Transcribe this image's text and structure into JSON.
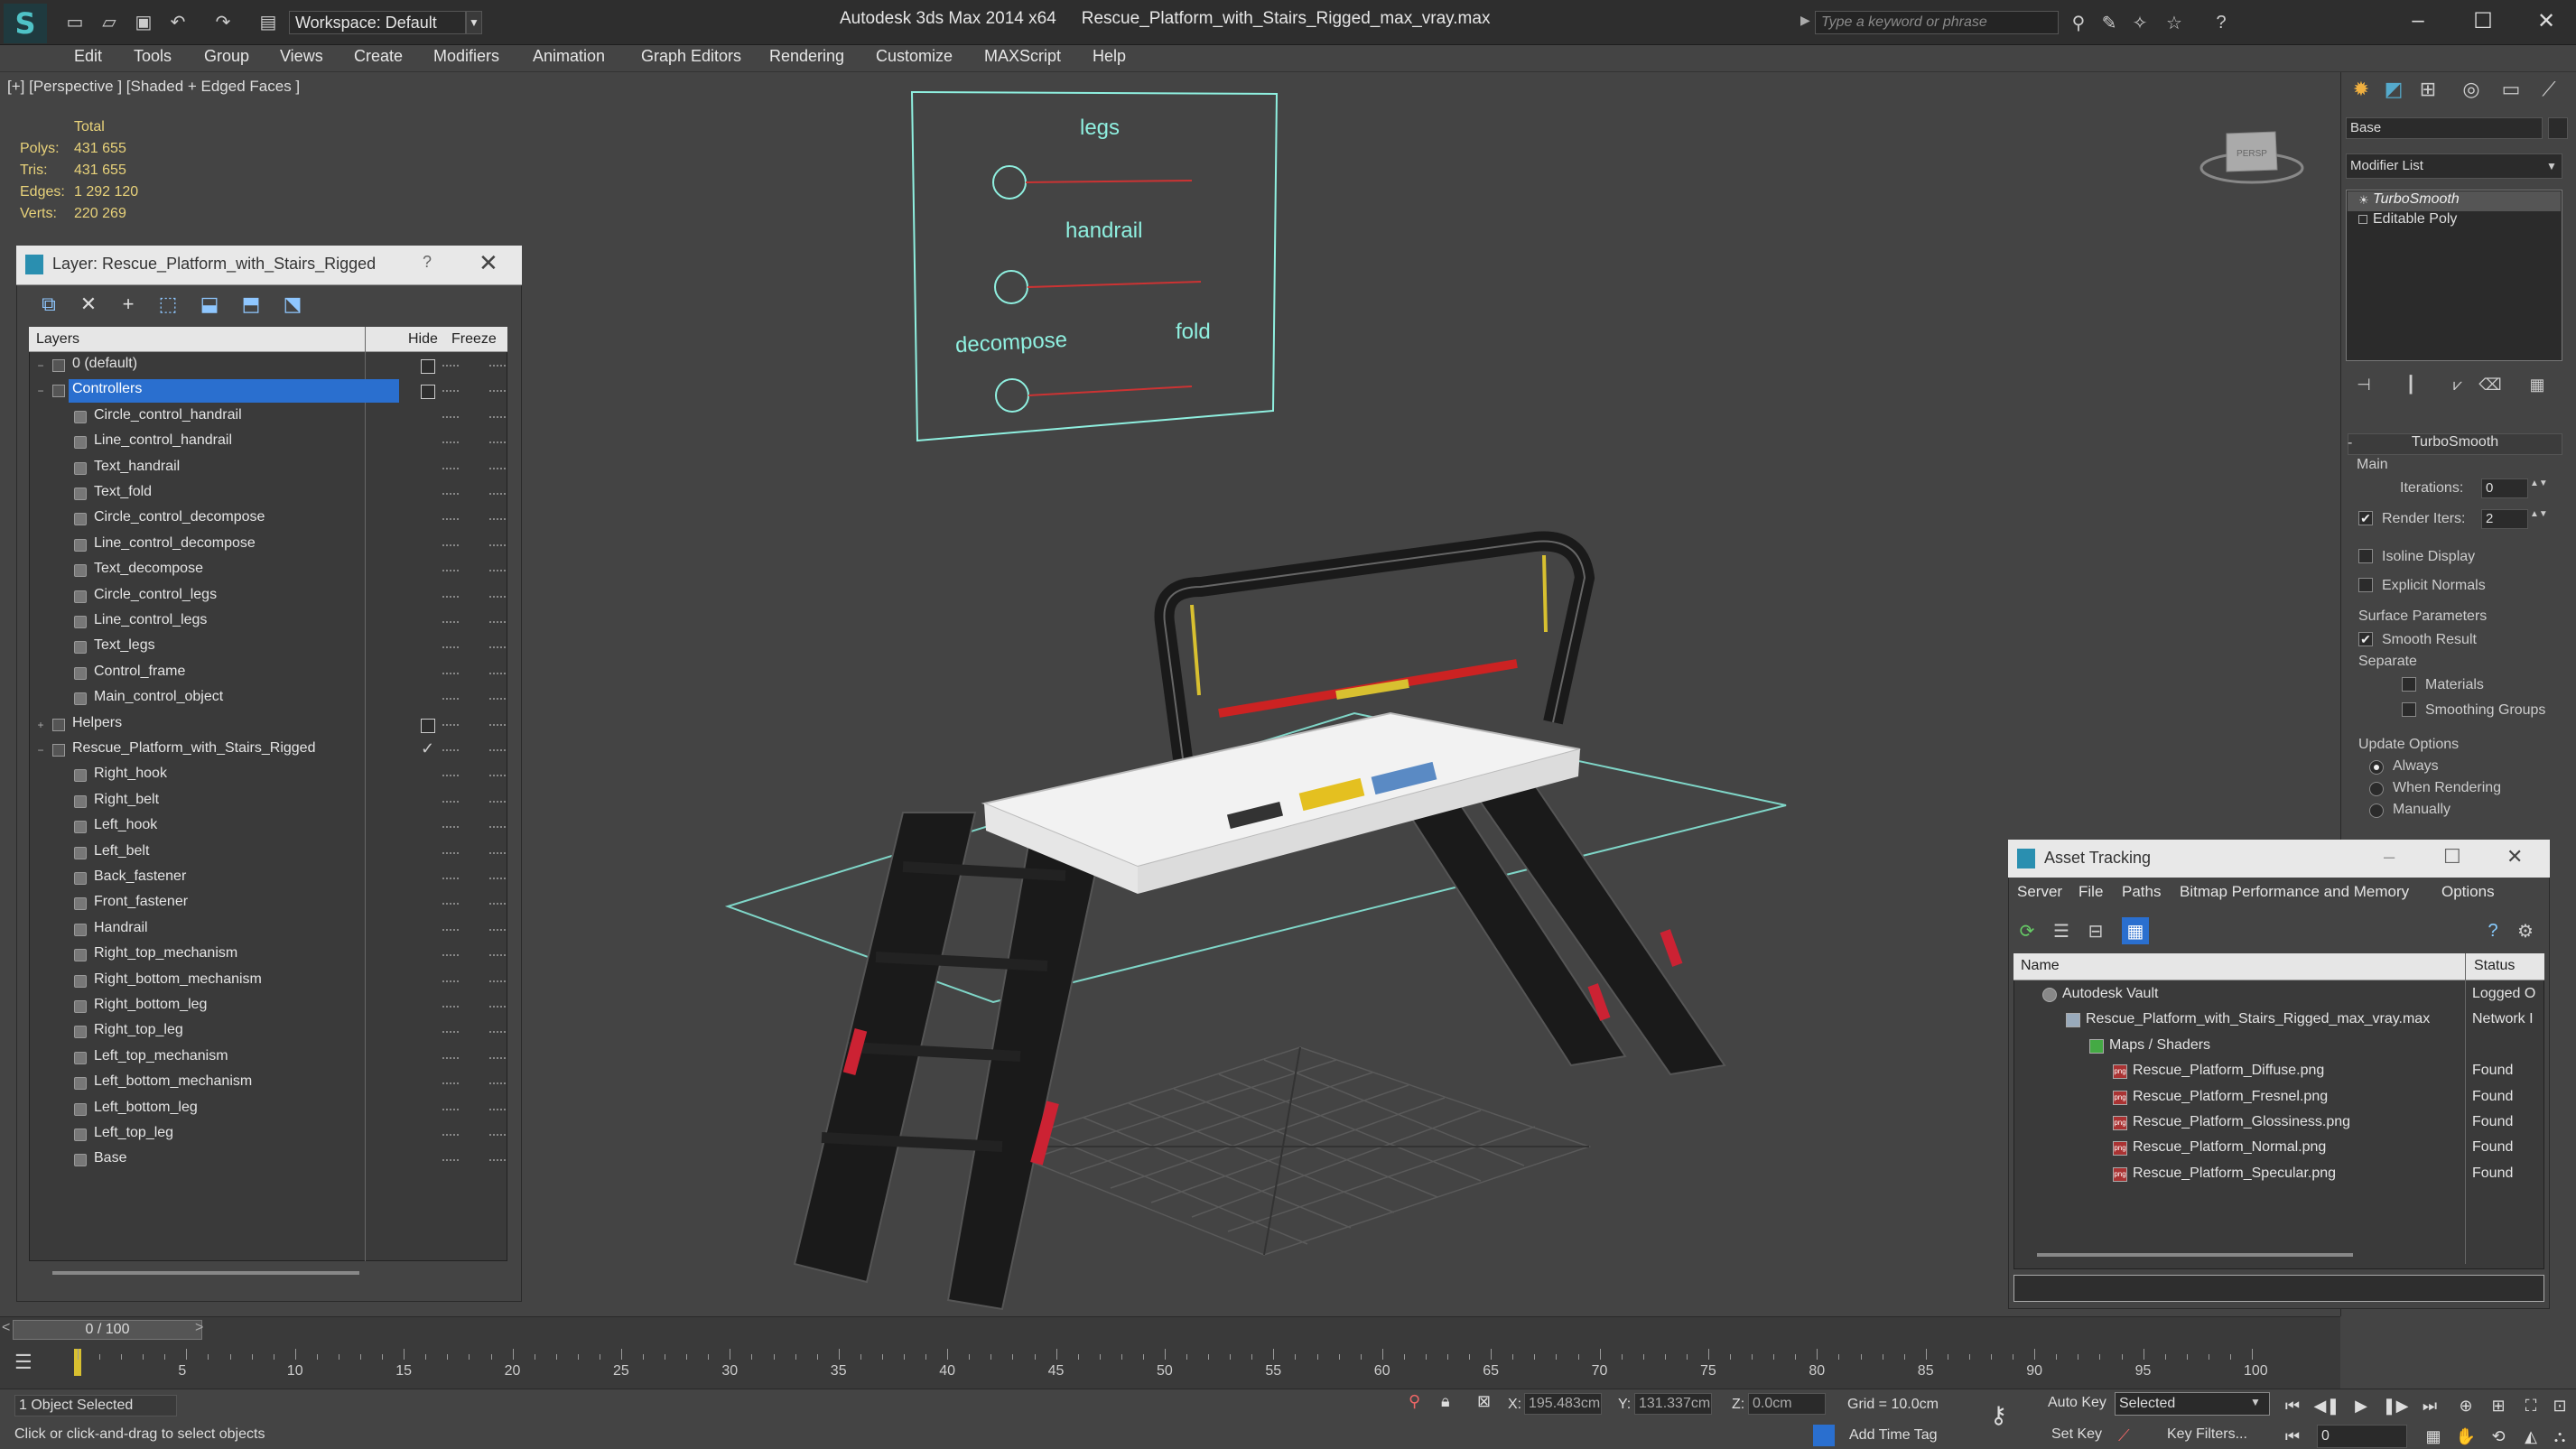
{
  "titlebar": {
    "workspace": "Workspace: Default",
    "app_name": "Autodesk 3ds Max  2014 x64",
    "file_name": "Rescue_Platform_with_Stairs_Rigged_max_vray.max",
    "search_placeholder": "Type a keyword or phrase"
  },
  "menu": [
    "Edit",
    "Tools",
    "Group",
    "Views",
    "Create",
    "Modifiers",
    "Animation",
    "Graph Editors",
    "Rendering",
    "Customize",
    "MAXScript",
    "Help"
  ],
  "viewport": {
    "label": "[+] [Perspective ] [Shaded + Edged Faces ]",
    "stats": {
      "header": "Total",
      "rows": [
        {
          "label": "Polys:",
          "value": "431 655"
        },
        {
          "label": "Tris:",
          "value": "431 655"
        },
        {
          "label": "Edges:",
          "value": "1 292 120"
        },
        {
          "label": "Verts:",
          "value": "220 269"
        }
      ]
    },
    "control_frame": {
      "legs": "legs",
      "handrail": "handrail",
      "decompose": "decompose",
      "fold": "fold"
    },
    "viewcube_label": "PERSP"
  },
  "layer_panel": {
    "title": "Layer: Rescue_Platform_with_Stairs_Rigged",
    "help": "?",
    "columns": {
      "layers": "Layers",
      "hide": "Hide",
      "freeze": "Freeze"
    },
    "rows": [
      {
        "name": "0 (default)",
        "level": 0,
        "type": "layer",
        "hidebox": true
      },
      {
        "name": "Controllers",
        "level": 0,
        "type": "layer",
        "hidebox": true,
        "selected": true,
        "expanded": true
      },
      {
        "name": "Circle_control_handrail",
        "level": 1,
        "type": "object"
      },
      {
        "name": "Line_control_handrail",
        "level": 1,
        "type": "object"
      },
      {
        "name": "Text_handrail",
        "level": 1,
        "type": "object"
      },
      {
        "name": "Text_fold",
        "level": 1,
        "type": "object"
      },
      {
        "name": "Circle_control_decompose",
        "level": 1,
        "type": "object"
      },
      {
        "name": "Line_control_decompose",
        "level": 1,
        "type": "object"
      },
      {
        "name": "Text_decompose",
        "level": 1,
        "type": "object"
      },
      {
        "name": "Circle_control_legs",
        "level": 1,
        "type": "object"
      },
      {
        "name": "Line_control_legs",
        "level": 1,
        "type": "object"
      },
      {
        "name": "Text_legs",
        "level": 1,
        "type": "object"
      },
      {
        "name": "Control_frame",
        "level": 1,
        "type": "object"
      },
      {
        "name": "Main_control_object",
        "level": 1,
        "type": "object"
      },
      {
        "name": "Helpers",
        "level": 0,
        "type": "layer",
        "hidebox": true,
        "collapsed": true
      },
      {
        "name": "Rescue_Platform_with_Stairs_Rigged",
        "level": 0,
        "type": "layer",
        "check": true,
        "expanded": true
      },
      {
        "name": "Right_hook",
        "level": 1,
        "type": "object"
      },
      {
        "name": "Right_belt",
        "level": 1,
        "type": "object"
      },
      {
        "name": "Left_hook",
        "level": 1,
        "type": "object"
      },
      {
        "name": "Left_belt",
        "level": 1,
        "type": "object"
      },
      {
        "name": "Back_fastener",
        "level": 1,
        "type": "object"
      },
      {
        "name": "Front_fastener",
        "level": 1,
        "type": "object"
      },
      {
        "name": "Handrail",
        "level": 1,
        "type": "object"
      },
      {
        "name": "Right_top_mechanism",
        "level": 1,
        "type": "object"
      },
      {
        "name": "Right_bottom_mechanism",
        "level": 1,
        "type": "object"
      },
      {
        "name": "Right_bottom_leg",
        "level": 1,
        "type": "object"
      },
      {
        "name": "Right_top_leg",
        "level": 1,
        "type": "object"
      },
      {
        "name": "Left_top_mechanism",
        "level": 1,
        "type": "object"
      },
      {
        "name": "Left_bottom_mechanism",
        "level": 1,
        "type": "object"
      },
      {
        "name": "Left_bottom_leg",
        "level": 1,
        "type": "object"
      },
      {
        "name": "Left_top_leg",
        "level": 1,
        "type": "object"
      },
      {
        "name": "Base",
        "level": 1,
        "type": "object"
      }
    ]
  },
  "command_panel": {
    "object_name": "Base",
    "modifier_list": "Modifier List",
    "stack": [
      "TurboSmooth",
      "Editable Poly"
    ],
    "turbosmooth": {
      "title": "TurboSmooth",
      "main": "Main",
      "iterations_label": "Iterations:",
      "iterations": "0",
      "render_iters_label": "Render Iters:",
      "render_iters": "2",
      "render_iters_checked": true,
      "isoline": "Isoline Display",
      "explicit_normals": "Explicit Normals",
      "surface_params": "Surface Parameters",
      "smooth_result": "Smooth Result",
      "smooth_result_checked": true,
      "separate": "Separate",
      "materials": "Materials",
      "smoothing_groups": "Smoothing Groups",
      "update_options": "Update Options",
      "always": "Always",
      "when_rendering": "When Rendering",
      "manually": "Manually"
    }
  },
  "asset_tracking": {
    "title": "Asset Tracking",
    "menu": [
      "Server",
      "File",
      "Paths",
      "Bitmap Performance and Memory",
      "Options"
    ],
    "columns": {
      "name": "Name",
      "status": "Status"
    },
    "rows": [
      {
        "name": "Autodesk Vault",
        "status": "Logged O",
        "indent": 0
      },
      {
        "name": "Rescue_Platform_with_Stairs_Rigged_max_vray.max",
        "status": "Network I",
        "indent": 1
      },
      {
        "name": "Maps / Shaders",
        "status": "",
        "indent": 2
      },
      {
        "name": "Rescue_Platform_Diffuse.png",
        "status": "Found",
        "indent": 3
      },
      {
        "name": "Rescue_Platform_Fresnel.png",
        "status": "Found",
        "indent": 3
      },
      {
        "name": "Rescue_Platform_Glossiness.png",
        "status": "Found",
        "indent": 3
      },
      {
        "name": "Rescue_Platform_Normal.png",
        "status": "Found",
        "indent": 3
      },
      {
        "name": "Rescue_Platform_Specular.png",
        "status": "Found",
        "indent": 3
      }
    ]
  },
  "timeline": {
    "frame_display": "0 / 100",
    "ticks": [
      "5",
      "10",
      "15",
      "20",
      "25",
      "30",
      "35",
      "40",
      "45",
      "50",
      "55",
      "60",
      "65",
      "70",
      "75",
      "80",
      "85",
      "90",
      "95",
      "100"
    ]
  },
  "status": {
    "selection": "1 Object Selected",
    "prompt": "Click or click-and-drag to select objects",
    "x_label": "X:",
    "x": "195.483cm",
    "y_label": "Y:",
    "y": "131.337cm",
    "z_label": "Z:",
    "z": "0.0cm",
    "grid": "Grid = 10.0cm",
    "add_time_tag": "Add Time Tag",
    "auto_key": "Auto Key",
    "set_key": "Set Key",
    "selected": "Selected",
    "key_filters": "Key Filters...",
    "frame": "0"
  },
  "colors": {
    "accent": "#2a6fcf",
    "stats": "#e8d27a",
    "viewport": "#444444"
  }
}
